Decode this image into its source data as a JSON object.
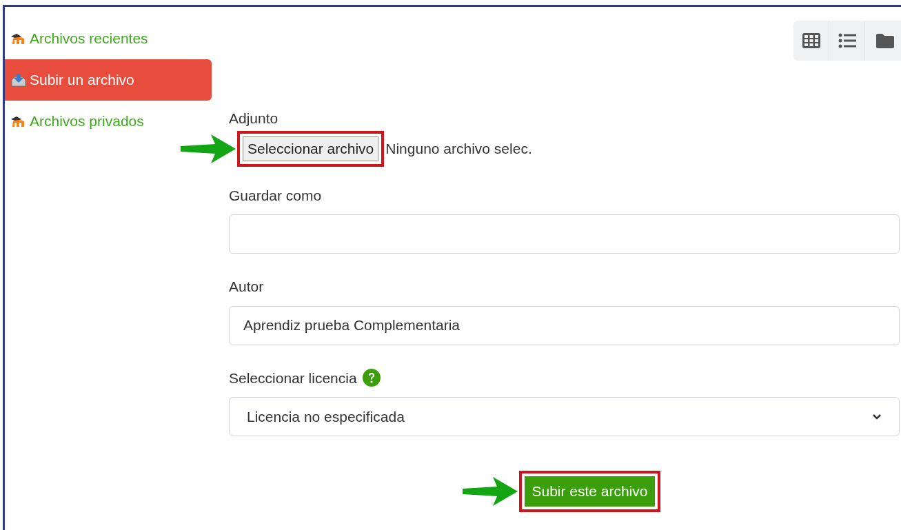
{
  "sidebar": {
    "items": [
      {
        "label": "Archivos recientes",
        "kind": "moodle",
        "selected": false
      },
      {
        "label": "Subir un archivo",
        "kind": "upload",
        "selected": true
      },
      {
        "label": "Archivos privados",
        "kind": "moodle",
        "selected": false
      }
    ]
  },
  "form": {
    "fields": [
      {
        "kind": "file",
        "label": "Adjunto",
        "button": "Seleccionar archivo",
        "status": "Ninguno archivo selec.",
        "highlighted": true
      },
      {
        "kind": "text",
        "label": "Guardar como"
      },
      {
        "kind": "text",
        "label": "Autor",
        "value": "Aprendiz prueba Complementaria"
      },
      {
        "kind": "select",
        "label": "Seleccionar licencia",
        "help": true,
        "value": "Licencia no especificada"
      }
    ],
    "submit": {
      "label": "Subir este archivo",
      "highlighted": true
    }
  }
}
